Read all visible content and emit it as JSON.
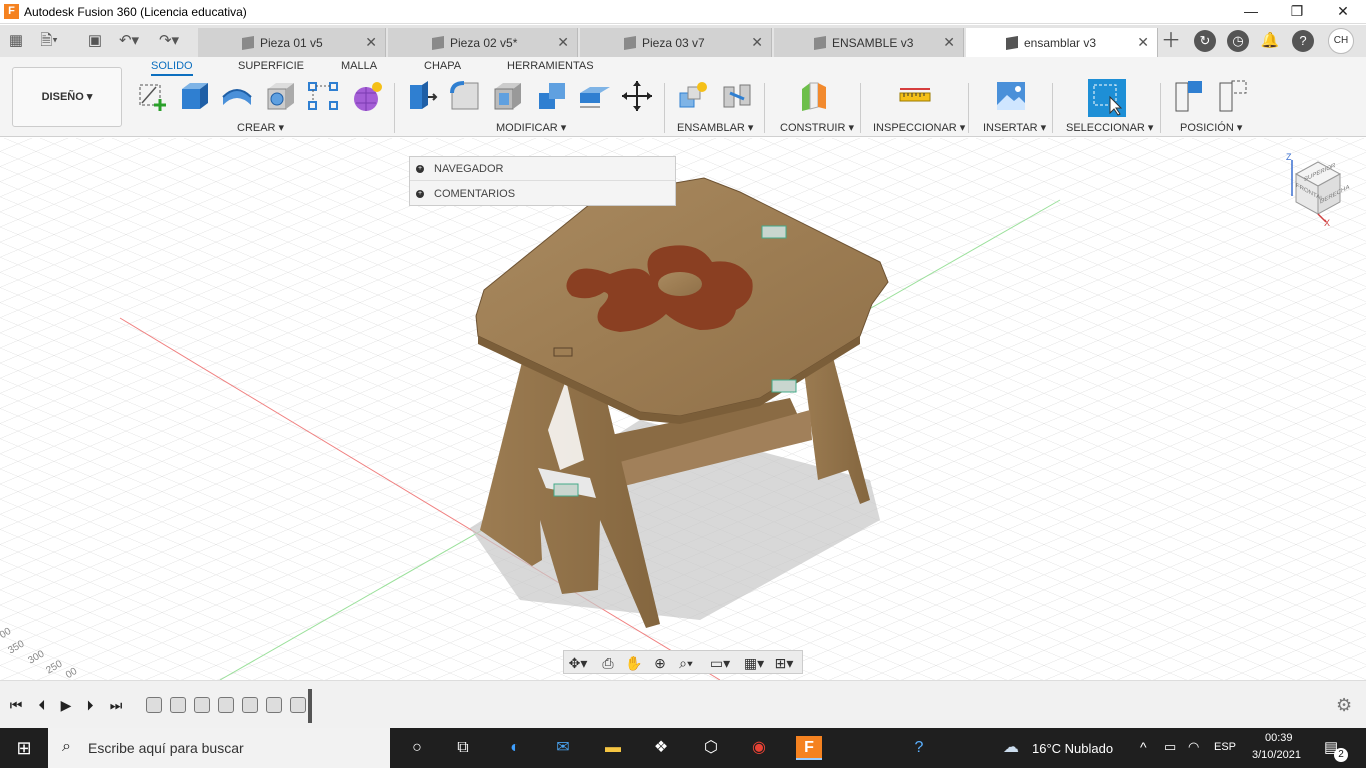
{
  "window": {
    "title": "Autodesk Fusion 360 (Licencia educativa)",
    "app_icon": "F"
  },
  "tabs": [
    {
      "label": "Pieza 01 v5"
    },
    {
      "label": "Pieza 02 v5*"
    },
    {
      "label": "Pieza 03 v7"
    },
    {
      "label": "ENSAMBLE v3"
    },
    {
      "label": "ensamblar v3"
    }
  ],
  "user_initials": "CH",
  "workspace": {
    "label": "DISEÑO ▾"
  },
  "ribbon_tabs": [
    "SOLIDO",
    "SUPERFICIE",
    "MALLA",
    "CHAPA",
    "HERRAMIENTAS"
  ],
  "groups": {
    "crear": "CREAR ▾",
    "modificar": "MODIFICAR ▾",
    "ensamblar": "ENSAMBLAR ▾",
    "construir": "CONSTRUIR ▾",
    "inspeccionar": "INSPECCIONAR ▾",
    "insertar": "INSERTAR ▾",
    "seleccionar": "SELECCIONAR ▾",
    "posicion": "POSICIÓN ▾"
  },
  "browser": {
    "navegador": "NAVEGADOR",
    "comentarios": "COMENTARIOS"
  },
  "viewcube": {
    "top": "SUPERIOR",
    "front": "FRONTAL",
    "right": "DERECHA",
    "z": "Z",
    "x": "X"
  },
  "grid_labels": [
    "350",
    "300",
    "250",
    "00",
    "00"
  ],
  "taskbar": {
    "search_placeholder": "Escribe aquí para buscar",
    "weather": "16°C  Nublado",
    "lang": "ESP",
    "time": "00:39",
    "date": "3/10/2021",
    "notif_count": "2"
  }
}
